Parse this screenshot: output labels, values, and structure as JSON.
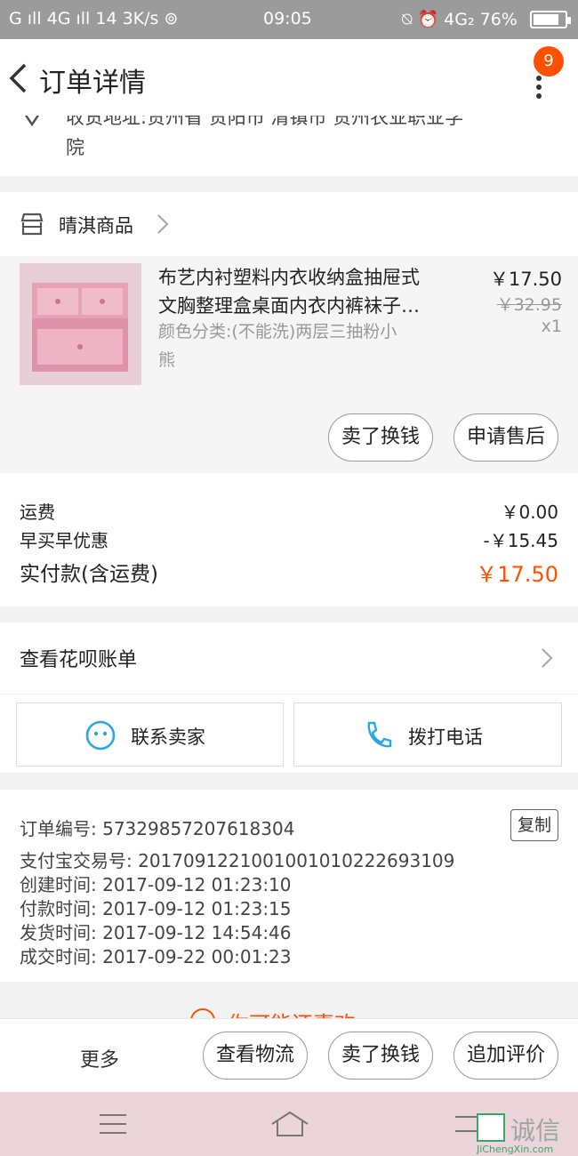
{
  "status": {
    "left": "G ıll  4G ıll  14  3K/s  ⊚",
    "time": "09:05",
    "right": "⍉  ⏰  4G₂ 76%"
  },
  "nav": {
    "title": "订单详情",
    "badge": "9"
  },
  "address": {
    "line1": "收货地址:贵州省 贵阳市 清镇市 贵州农业职业学",
    "line2": "院"
  },
  "shop": {
    "name": "晴淇商品"
  },
  "product": {
    "title_line1": "布艺内衬塑料内衣收纳盒抽屉式",
    "title_line2": "文胸整理盒桌面内衣内裤袜子…",
    "sku_line1": "颜色分类:(不能洗)两层三抽粉小",
    "sku_line2": "熊",
    "price": "￥17.50",
    "orig_price": "￥32.95",
    "qty": "x1",
    "btn_sell": "卖了换钱",
    "btn_aftersale": "申请售后"
  },
  "fees": {
    "shipping_label": "运费",
    "shipping_value": "￥0.00",
    "discount_label": "早买早优惠",
    "discount_value": "-￥15.45",
    "paid_label": "实付款(含运费)",
    "paid_value": "￥17.50"
  },
  "huabei": {
    "label": "查看花呗账单"
  },
  "contact": {
    "seller": "联系卖家",
    "phone": "拨打电话"
  },
  "info": {
    "order_no": "订单编号: 57329857207618304",
    "copy": "复制",
    "alipay_no": "支付宝交易号: 2017091221001001010222693109",
    "created": "创建时间: 2017-09-12  01:23:10",
    "paid": "付款时间: 2017-09-12  01:23:15",
    "shipped": "发货时间: 2017-09-12  14:54:46",
    "done": "成交时间: 2017-09-22  00:01:23"
  },
  "peek": {
    "text": "你可能还喜欢"
  },
  "bottom": {
    "more": "更多",
    "logistics": "查看物流",
    "sell": "卖了换钱",
    "review": "追加评价"
  },
  "watermark": {
    "text": "诚信",
    "sub": "JiChengXin.com"
  },
  "colors": {
    "accent": "#ff5000",
    "statusbar": "#9b9b9b",
    "homebar": "#ecd5da"
  }
}
